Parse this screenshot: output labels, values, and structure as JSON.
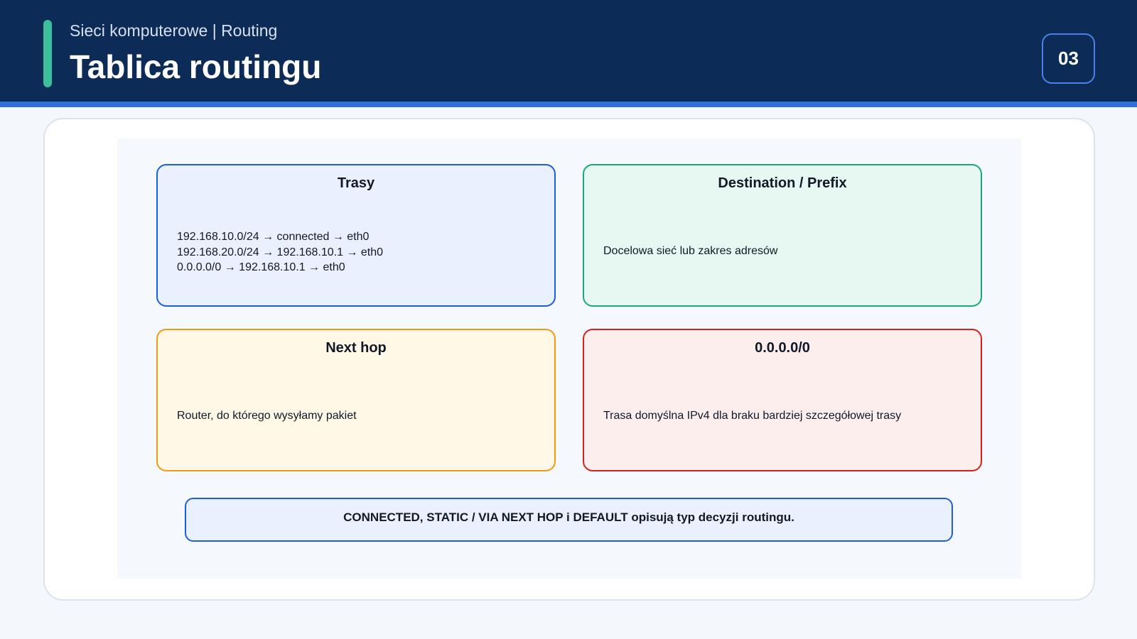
{
  "header": {
    "subtitle": "Sieci komputerowe | Routing",
    "title": "Tablica routingu",
    "page_number": "03"
  },
  "boxes": {
    "routes": {
      "title": "Trasy",
      "lines": [
        "192.168.10.0/24 → connected → eth0",
        "192.168.20.0/24 → 192.168.10.1 → eth0",
        "0.0.0.0/0 → 192.168.10.1 → eth0"
      ]
    },
    "destination": {
      "title": "Destination / Prefix",
      "body": "Docelowa sieć lub zakres adresów"
    },
    "next_hop": {
      "title": "Next hop",
      "body": "Router, do którego wysyłamy pakiet"
    },
    "default_route": {
      "title": "0.0.0.0/0",
      "body": "Trasa domyślna IPv4 dla braku bardziej szczegółowej trasy"
    }
  },
  "note": "CONNECTED, STATIC / VIA NEXT HOP i DEFAULT opisują typ decyzji routingu.",
  "colors": {
    "header_bg": "#0d2b57",
    "accent": "#3bbf9e",
    "blue": "#1f5fd6",
    "green": "#1aa87a",
    "orange": "#f09a16",
    "red": "#d32020"
  }
}
